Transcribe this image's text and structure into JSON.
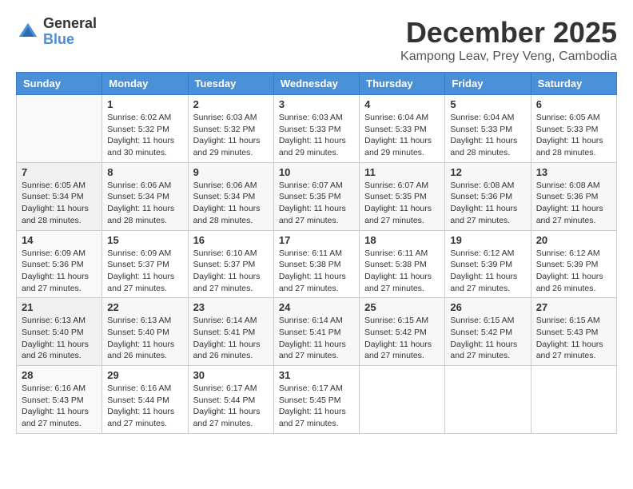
{
  "header": {
    "logo_general": "General",
    "logo_blue": "Blue",
    "month_title": "December 2025",
    "location": "Kampong Leav, Prey Veng, Cambodia"
  },
  "calendar": {
    "days_of_week": [
      "Sunday",
      "Monday",
      "Tuesday",
      "Wednesday",
      "Thursday",
      "Friday",
      "Saturday"
    ],
    "weeks": [
      [
        {
          "day": "",
          "info": ""
        },
        {
          "day": "1",
          "info": "Sunrise: 6:02 AM\nSunset: 5:32 PM\nDaylight: 11 hours\nand 30 minutes."
        },
        {
          "day": "2",
          "info": "Sunrise: 6:03 AM\nSunset: 5:32 PM\nDaylight: 11 hours\nand 29 minutes."
        },
        {
          "day": "3",
          "info": "Sunrise: 6:03 AM\nSunset: 5:33 PM\nDaylight: 11 hours\nand 29 minutes."
        },
        {
          "day": "4",
          "info": "Sunrise: 6:04 AM\nSunset: 5:33 PM\nDaylight: 11 hours\nand 29 minutes."
        },
        {
          "day": "5",
          "info": "Sunrise: 6:04 AM\nSunset: 5:33 PM\nDaylight: 11 hours\nand 28 minutes."
        },
        {
          "day": "6",
          "info": "Sunrise: 6:05 AM\nSunset: 5:33 PM\nDaylight: 11 hours\nand 28 minutes."
        }
      ],
      [
        {
          "day": "7",
          "info": "Sunrise: 6:05 AM\nSunset: 5:34 PM\nDaylight: 11 hours\nand 28 minutes."
        },
        {
          "day": "8",
          "info": "Sunrise: 6:06 AM\nSunset: 5:34 PM\nDaylight: 11 hours\nand 28 minutes."
        },
        {
          "day": "9",
          "info": "Sunrise: 6:06 AM\nSunset: 5:34 PM\nDaylight: 11 hours\nand 28 minutes."
        },
        {
          "day": "10",
          "info": "Sunrise: 6:07 AM\nSunset: 5:35 PM\nDaylight: 11 hours\nand 27 minutes."
        },
        {
          "day": "11",
          "info": "Sunrise: 6:07 AM\nSunset: 5:35 PM\nDaylight: 11 hours\nand 27 minutes."
        },
        {
          "day": "12",
          "info": "Sunrise: 6:08 AM\nSunset: 5:36 PM\nDaylight: 11 hours\nand 27 minutes."
        },
        {
          "day": "13",
          "info": "Sunrise: 6:08 AM\nSunset: 5:36 PM\nDaylight: 11 hours\nand 27 minutes."
        }
      ],
      [
        {
          "day": "14",
          "info": "Sunrise: 6:09 AM\nSunset: 5:36 PM\nDaylight: 11 hours\nand 27 minutes."
        },
        {
          "day": "15",
          "info": "Sunrise: 6:09 AM\nSunset: 5:37 PM\nDaylight: 11 hours\nand 27 minutes."
        },
        {
          "day": "16",
          "info": "Sunrise: 6:10 AM\nSunset: 5:37 PM\nDaylight: 11 hours\nand 27 minutes."
        },
        {
          "day": "17",
          "info": "Sunrise: 6:11 AM\nSunset: 5:38 PM\nDaylight: 11 hours\nand 27 minutes."
        },
        {
          "day": "18",
          "info": "Sunrise: 6:11 AM\nSunset: 5:38 PM\nDaylight: 11 hours\nand 27 minutes."
        },
        {
          "day": "19",
          "info": "Sunrise: 6:12 AM\nSunset: 5:39 PM\nDaylight: 11 hours\nand 27 minutes."
        },
        {
          "day": "20",
          "info": "Sunrise: 6:12 AM\nSunset: 5:39 PM\nDaylight: 11 hours\nand 26 minutes."
        }
      ],
      [
        {
          "day": "21",
          "info": "Sunrise: 6:13 AM\nSunset: 5:40 PM\nDaylight: 11 hours\nand 26 minutes."
        },
        {
          "day": "22",
          "info": "Sunrise: 6:13 AM\nSunset: 5:40 PM\nDaylight: 11 hours\nand 26 minutes."
        },
        {
          "day": "23",
          "info": "Sunrise: 6:14 AM\nSunset: 5:41 PM\nDaylight: 11 hours\nand 26 minutes."
        },
        {
          "day": "24",
          "info": "Sunrise: 6:14 AM\nSunset: 5:41 PM\nDaylight: 11 hours\nand 27 minutes."
        },
        {
          "day": "25",
          "info": "Sunrise: 6:15 AM\nSunset: 5:42 PM\nDaylight: 11 hours\nand 27 minutes."
        },
        {
          "day": "26",
          "info": "Sunrise: 6:15 AM\nSunset: 5:42 PM\nDaylight: 11 hours\nand 27 minutes."
        },
        {
          "day": "27",
          "info": "Sunrise: 6:15 AM\nSunset: 5:43 PM\nDaylight: 11 hours\nand 27 minutes."
        }
      ],
      [
        {
          "day": "28",
          "info": "Sunrise: 6:16 AM\nSunset: 5:43 PM\nDaylight: 11 hours\nand 27 minutes."
        },
        {
          "day": "29",
          "info": "Sunrise: 6:16 AM\nSunset: 5:44 PM\nDaylight: 11 hours\nand 27 minutes."
        },
        {
          "day": "30",
          "info": "Sunrise: 6:17 AM\nSunset: 5:44 PM\nDaylight: 11 hours\nand 27 minutes."
        },
        {
          "day": "31",
          "info": "Sunrise: 6:17 AM\nSunset: 5:45 PM\nDaylight: 11 hours\nand 27 minutes."
        },
        {
          "day": "",
          "info": ""
        },
        {
          "day": "",
          "info": ""
        },
        {
          "day": "",
          "info": ""
        }
      ]
    ]
  }
}
